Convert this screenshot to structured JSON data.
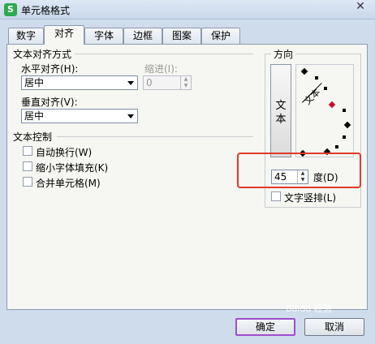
{
  "window": {
    "title": "单元格格式",
    "app_icon_glyph": "S",
    "close_glyph": "✕"
  },
  "tabs": [
    {
      "label": "数字"
    },
    {
      "label": "对齐"
    },
    {
      "label": "字体"
    },
    {
      "label": "边框"
    },
    {
      "label": "图案"
    },
    {
      "label": "保护"
    }
  ],
  "alignment": {
    "section_title": "文本对齐方式",
    "horizontal_label": "水平对齐(H):",
    "horizontal_value": "居中",
    "indent_label": "缩进(I):",
    "indent_value": "0",
    "vertical_label": "垂直对齐(V):",
    "vertical_value": "居中"
  },
  "text_control": {
    "section_title": "文本控制",
    "wrap_label": "自动换行(W)",
    "shrink_label": "缩小字体填充(K)",
    "merge_label": "合并单元格(M)"
  },
  "orientation": {
    "section_title": "方向",
    "vertical_text_button": "文本",
    "dial_label": "文本",
    "degree_value": "45",
    "degree_label": "度(D)",
    "vertical_stack_label": "文字竖排(L)"
  },
  "buttons": {
    "ok": "确定",
    "cancel": "取消"
  },
  "watermark": "Baidu 经验",
  "colors": {
    "highlight": "#e03b2a",
    "default_button_border": "#a04fc8",
    "dial_selected": "#c8102e"
  }
}
